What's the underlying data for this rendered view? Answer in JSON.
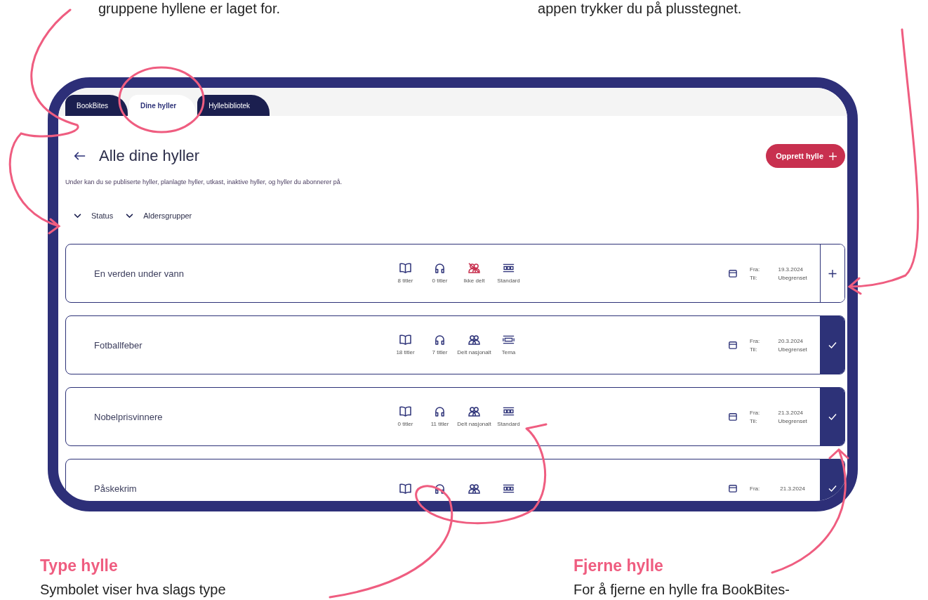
{
  "notes_top": [
    "gruppene hyllene er laget for.",
    "appen trykker du på plusstegnet."
  ],
  "tabs": [
    {
      "label": "BookBites",
      "selected": false
    },
    {
      "label": "Dine hyller",
      "selected": true
    },
    {
      "label": "Hyllebibliotek",
      "selected": false
    }
  ],
  "page": {
    "title": "Alle dine hyller",
    "create_button": "Opprett hylle",
    "description": "Under kan du se publiserte hyller, planlagte hyller, utkast, inaktive hyller, og hyller du abonnerer på.",
    "filters": [
      "Status",
      "Aldersgrupper"
    ]
  },
  "rows": [
    {
      "title": "En verden under vann",
      "stats": [
        {
          "kind": "books",
          "label": "8 titler"
        },
        {
          "kind": "audio",
          "label": "0 titler"
        },
        {
          "kind": "not-shared",
          "label": "Ikke delt"
        },
        {
          "kind": "standard",
          "label": "Standard"
        }
      ],
      "from_label": "Fra:",
      "from": "19.3.2024",
      "to_label": "Til:",
      "to": "Ubegrenset",
      "added": false
    },
    {
      "title": "Fotballfeber",
      "stats": [
        {
          "kind": "books",
          "label": "18 titler"
        },
        {
          "kind": "audio",
          "label": "7 titler"
        },
        {
          "kind": "shared",
          "label": "Delt nasjonalt"
        },
        {
          "kind": "theme",
          "label": "Tema"
        }
      ],
      "from_label": "Fra:",
      "from": "20.3.2024",
      "to_label": "Til:",
      "to": "Ubegrenset",
      "added": true
    },
    {
      "title": "Nobelprisvinnere",
      "stats": [
        {
          "kind": "books",
          "label": "0 titler"
        },
        {
          "kind": "audio",
          "label": "11 titler"
        },
        {
          "kind": "shared",
          "label": "Delt nasjonalt"
        },
        {
          "kind": "standard",
          "label": "Standard"
        }
      ],
      "from_label": "Fra:",
      "from": "21.3.2024",
      "to_label": "Til:",
      "to": "Ubegrenset",
      "added": true
    },
    {
      "title": "Påskekrim",
      "stats": [
        {
          "kind": "books"
        },
        {
          "kind": "audio"
        },
        {
          "kind": "shared"
        },
        {
          "kind": "standard"
        }
      ],
      "from_label": "Fra:",
      "from": "21.3.2024",
      "added": true
    }
  ],
  "notes_bottom": [
    {
      "heading": "Type hylle",
      "text": "Symbolet viser hva slags type"
    },
    {
      "heading": "Fjerne hylle",
      "text": "For å fjerne en hylle fra BookBites-"
    }
  ]
}
